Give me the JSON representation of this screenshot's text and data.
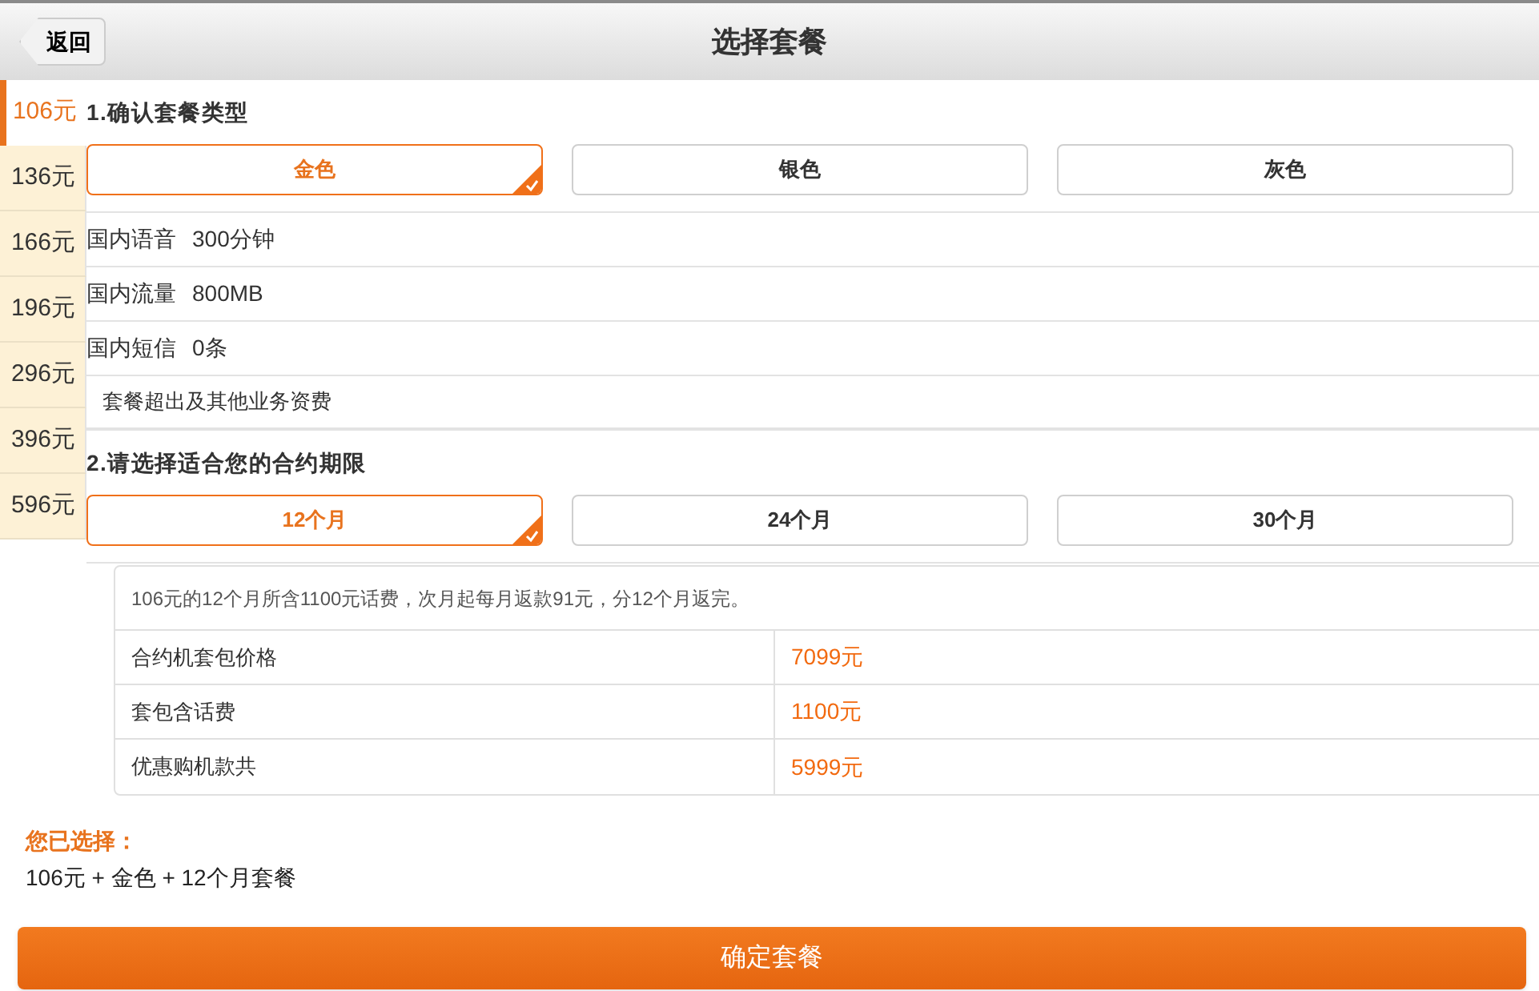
{
  "header": {
    "back": "返回",
    "title": "选择套餐"
  },
  "prices": [
    {
      "label": "106元",
      "selected": true
    },
    {
      "label": "136元",
      "selected": false
    },
    {
      "label": "166元",
      "selected": false
    },
    {
      "label": "196元",
      "selected": false
    },
    {
      "label": "296元",
      "selected": false
    },
    {
      "label": "396元",
      "selected": false
    },
    {
      "label": "596元",
      "selected": false
    }
  ],
  "section1": {
    "title": "1.确认套餐类型",
    "options": [
      {
        "label": "金色",
        "selected": true
      },
      {
        "label": "银色",
        "selected": false
      },
      {
        "label": "灰色",
        "selected": false
      }
    ],
    "features": [
      {
        "name": "国内语音",
        "value": "300分钟"
      },
      {
        "name": "国内流量",
        "value": "800MB"
      },
      {
        "name": "国内短信",
        "value": "0条"
      }
    ],
    "more": "套餐超出及其他业务资费"
  },
  "section2": {
    "title": "2.请选择适合您的合约期限",
    "options": [
      {
        "label": "12个月",
        "selected": true
      },
      {
        "label": "24个月",
        "selected": false
      },
      {
        "label": "30个月",
        "selected": false
      }
    ],
    "note": "106元的12个月所含1100元话费，次月起每月返款91元，分12个月返完。",
    "rows": [
      {
        "name": "合约机套包价格",
        "value": "7099元"
      },
      {
        "name": "套包含话费",
        "value": "1100元"
      },
      {
        "name": "优惠购机款共",
        "value": "5999元"
      }
    ]
  },
  "summary": {
    "label": "您已选择：",
    "text": "106元 + 金色 + 12个月套餐"
  },
  "confirm": "确定套餐"
}
